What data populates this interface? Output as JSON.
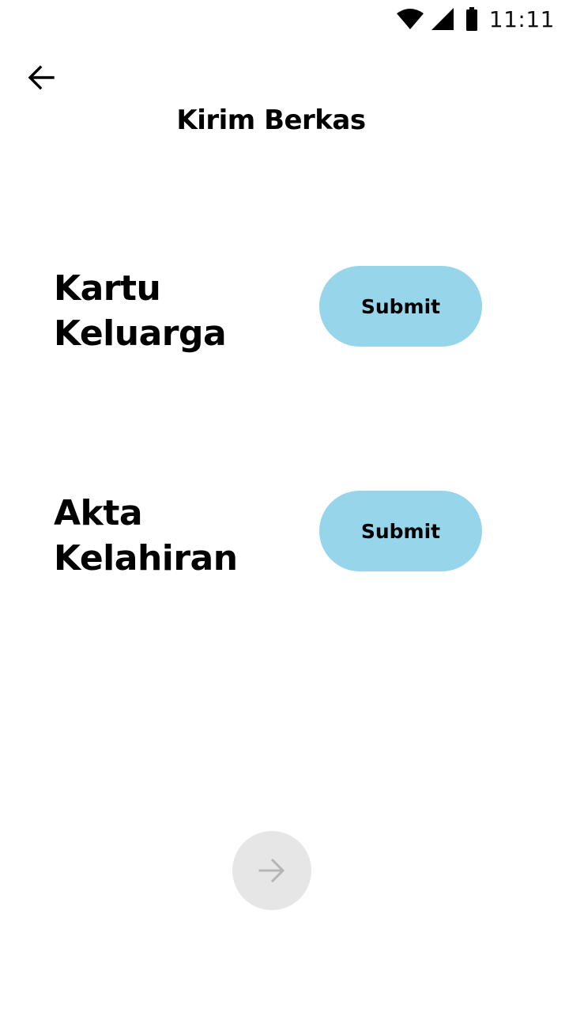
{
  "status_bar": {
    "time": "11:11",
    "icons": [
      "wifi-icon",
      "signal-icon",
      "battery-icon"
    ]
  },
  "header": {
    "back_icon": "arrow-left-icon",
    "title": "Kirim Berkas"
  },
  "documents": [
    {
      "label_line1": "Kartu",
      "label_line2": "Keluarga",
      "button_label": "Submit"
    },
    {
      "label_line1": "Akta",
      "label_line2": "Kelahiran",
      "button_label": "Submit"
    }
  ],
  "footer": {
    "next_icon": "arrow-right-icon",
    "next_enabled": false
  },
  "colors": {
    "submit_button_bg": "#97d6ea",
    "next_button_bg": "#e6e6e6",
    "next_icon_color": "#b5b5b5",
    "text": "#000000"
  }
}
